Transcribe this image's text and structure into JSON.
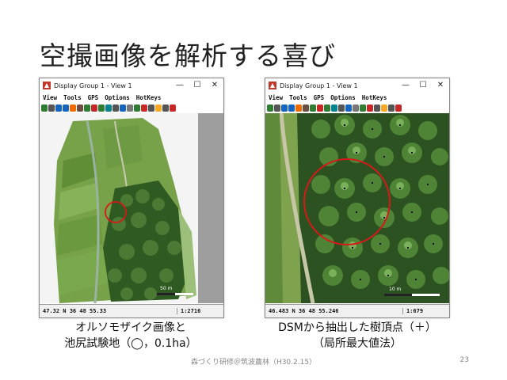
{
  "slide": {
    "title": "空撮画像を解析する喜び",
    "footer": "森づくり研修＠筑波農林（H30.2.15）",
    "page_number": "23"
  },
  "windows": [
    {
      "title": "Display Group 1 - View 1",
      "menu": [
        "View",
        "Tools",
        "GPS",
        "Options",
        "HotKeys"
      ],
      "status_coord": "47.32  N 36 48 55.33",
      "status_scale": "1:2716",
      "scalebar_label": "50 m",
      "caption_lines": [
        "オルソモザイク画像と",
        "池尻試験地（◯，0.1ha）"
      ]
    },
    {
      "title": "Display Group 1 - View 1",
      "menu": [
        "View",
        "Tools",
        "GPS",
        "Options",
        "HotKeys"
      ],
      "status_coord": "46.483  N 36 48 55.246",
      "status_scale": "1:679",
      "scalebar_label": "10 m",
      "caption_lines": [
        "DSMから抽出した樹頂点（＋）",
        "（局所最大値法）"
      ]
    }
  ],
  "window_controls": {
    "minimize": "—",
    "maximize": "☐",
    "close": "✕"
  },
  "colors": {
    "marker_circle": "#d61a1a",
    "forest_dark": "#2f5a22",
    "field_green": "#6d9a42",
    "toolbar_accent": "#3a7a3a"
  }
}
